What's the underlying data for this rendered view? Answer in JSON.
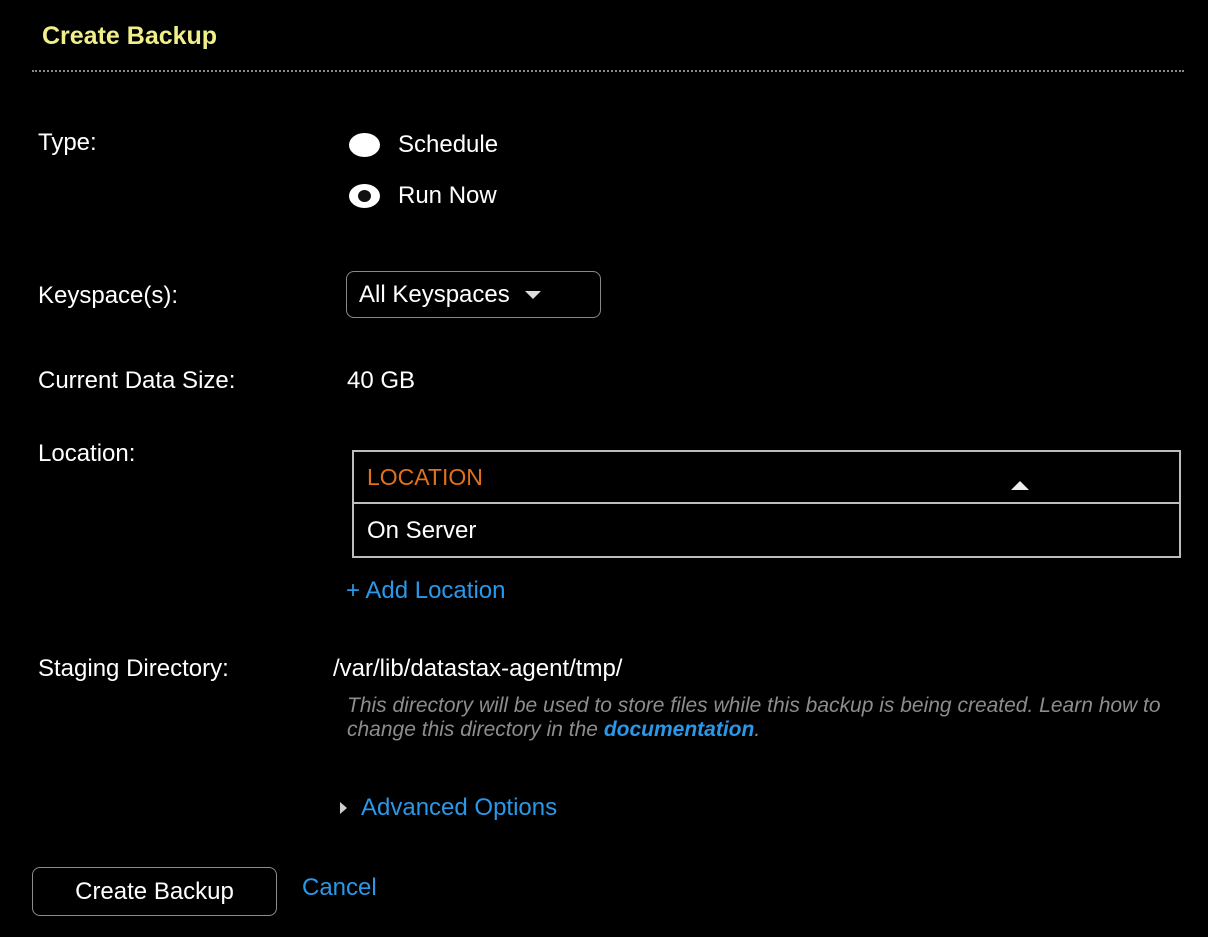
{
  "dialog": {
    "title": "Create Backup",
    "accent_color": "#f1ef8a"
  },
  "type": {
    "label": "Type:",
    "options": [
      {
        "label": "Schedule",
        "selected": false
      },
      {
        "label": "Run Now",
        "selected": true
      }
    ]
  },
  "keyspaces": {
    "label": "Keyspace(s):",
    "selected": "All Keyspaces"
  },
  "data_size": {
    "label": "Current Data Size:",
    "value": "40 GB"
  },
  "location": {
    "label": "Location:",
    "column_header": "LOCATION",
    "header_color": "#e0701c",
    "rows": [
      "On Server"
    ],
    "add_link": "+ Add Location"
  },
  "staging": {
    "label": "Staging Directory:",
    "value": "/var/lib/datastax-agent/tmp/",
    "help_before": "This directory will be used to store files while this backup is being created. Learn how to change this directory in the ",
    "help_link": "documentation",
    "help_after": "."
  },
  "advanced": {
    "label": "Advanced Options"
  },
  "actions": {
    "submit_label": "Create Backup",
    "cancel_label": "Cancel",
    "link_color": "#2a98e8"
  }
}
